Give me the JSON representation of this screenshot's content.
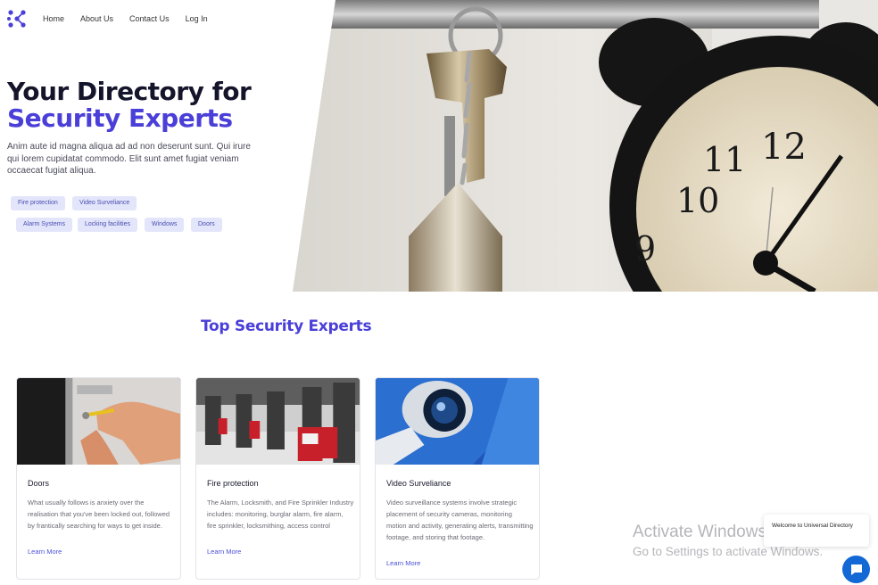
{
  "nav": {
    "links": [
      "Home",
      "About Us",
      "Contact Us",
      "Log In"
    ]
  },
  "hero": {
    "title_line1": "Your Directory for",
    "title_line2": "Security Experts",
    "description": "Anim aute id magna aliqua ad ad non deserunt sunt. Qui irure qui lorem cupidatat commodo. Elit sunt amet fugiat veniam occaecat fugiat aliqua.",
    "tags": [
      "Fire protection",
      "Video Surveliance",
      "Alarm Systems",
      "Locking facilities",
      "Windows",
      "Doors"
    ]
  },
  "section": {
    "title": "Top Security Experts"
  },
  "cards": [
    {
      "title": "Doors",
      "text": "What usually follows is anxiety over the realisation that you've been locked out, followed by frantically searching for ways to get inside.",
      "link": "Learn More"
    },
    {
      "title": "Fire protection",
      "text": "The Alarm, Locksmith, and Fire Sprinkler Industry includes: monitoring, burglar alarm, fire alarm, fire sprinkler, locksmithing, access control",
      "link": "Learn More"
    },
    {
      "title": "Video Surveliance",
      "text": "Video surveillance systems involve strategic placement of security cameras, monitoring motion and activity, generating alerts, transmitting footage, and storing that footage.",
      "link": "Learn More"
    }
  ],
  "watermark": {
    "line1": "Activate Windows",
    "line2": "Go to Settings to activate Windows."
  },
  "chat": {
    "message": "Welcome to Universal Directory"
  },
  "colors": {
    "accent": "#4a3fd8",
    "tag_bg": "#e3e5fb",
    "chat_button": "#1268d4"
  },
  "icons": [
    "logo-icon",
    "chat-icon"
  ]
}
